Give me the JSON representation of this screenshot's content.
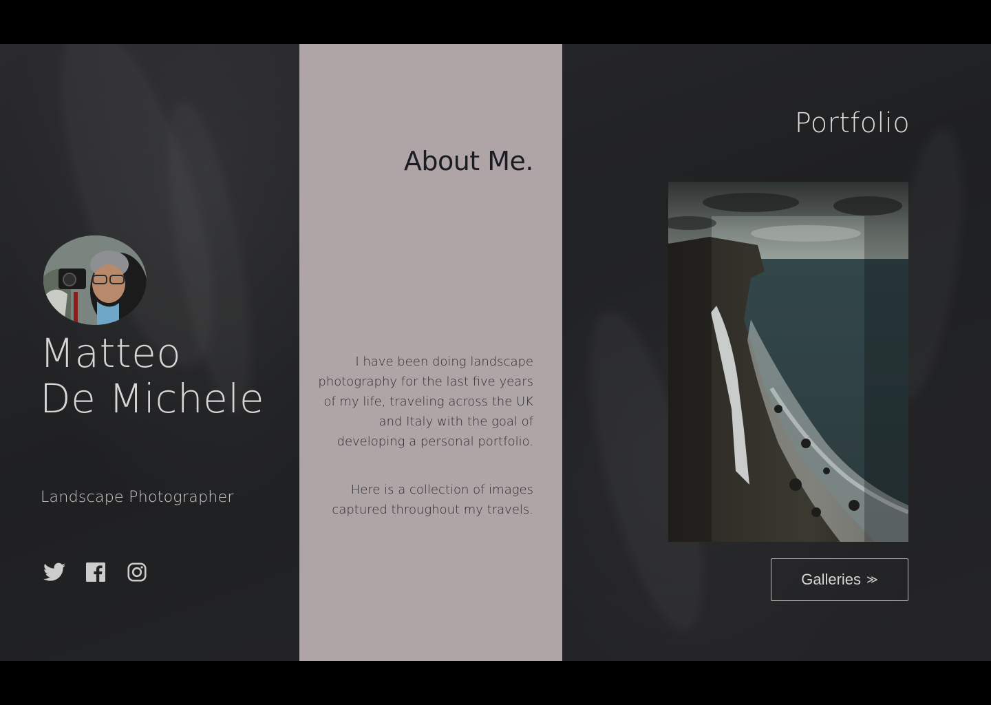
{
  "profile": {
    "first_name": "Matteo",
    "last_name": "De Michele",
    "tagline": "Landscape Photographer"
  },
  "social": [
    {
      "icon": "twitter-icon"
    },
    {
      "icon": "facebook-icon"
    },
    {
      "icon": "instagram-icon"
    }
  ],
  "about": {
    "heading": "About Me.",
    "paragraph_1": "I have been doing landscape photography for the last five years of my life, traveling across the UK and Italy with the goal of developing a personal portfolio.",
    "paragraph_2": "Here is a collection of images captured throughout my travels."
  },
  "portfolio": {
    "heading": "Portfolio",
    "button_label": "Galleries",
    "button_icon": "double-chevron-right-icon"
  },
  "colors": {
    "about_panel": "#b0a5a6",
    "background": "#222325",
    "text_light": "#d8d6d4",
    "text_dark": "#1a1c22"
  }
}
